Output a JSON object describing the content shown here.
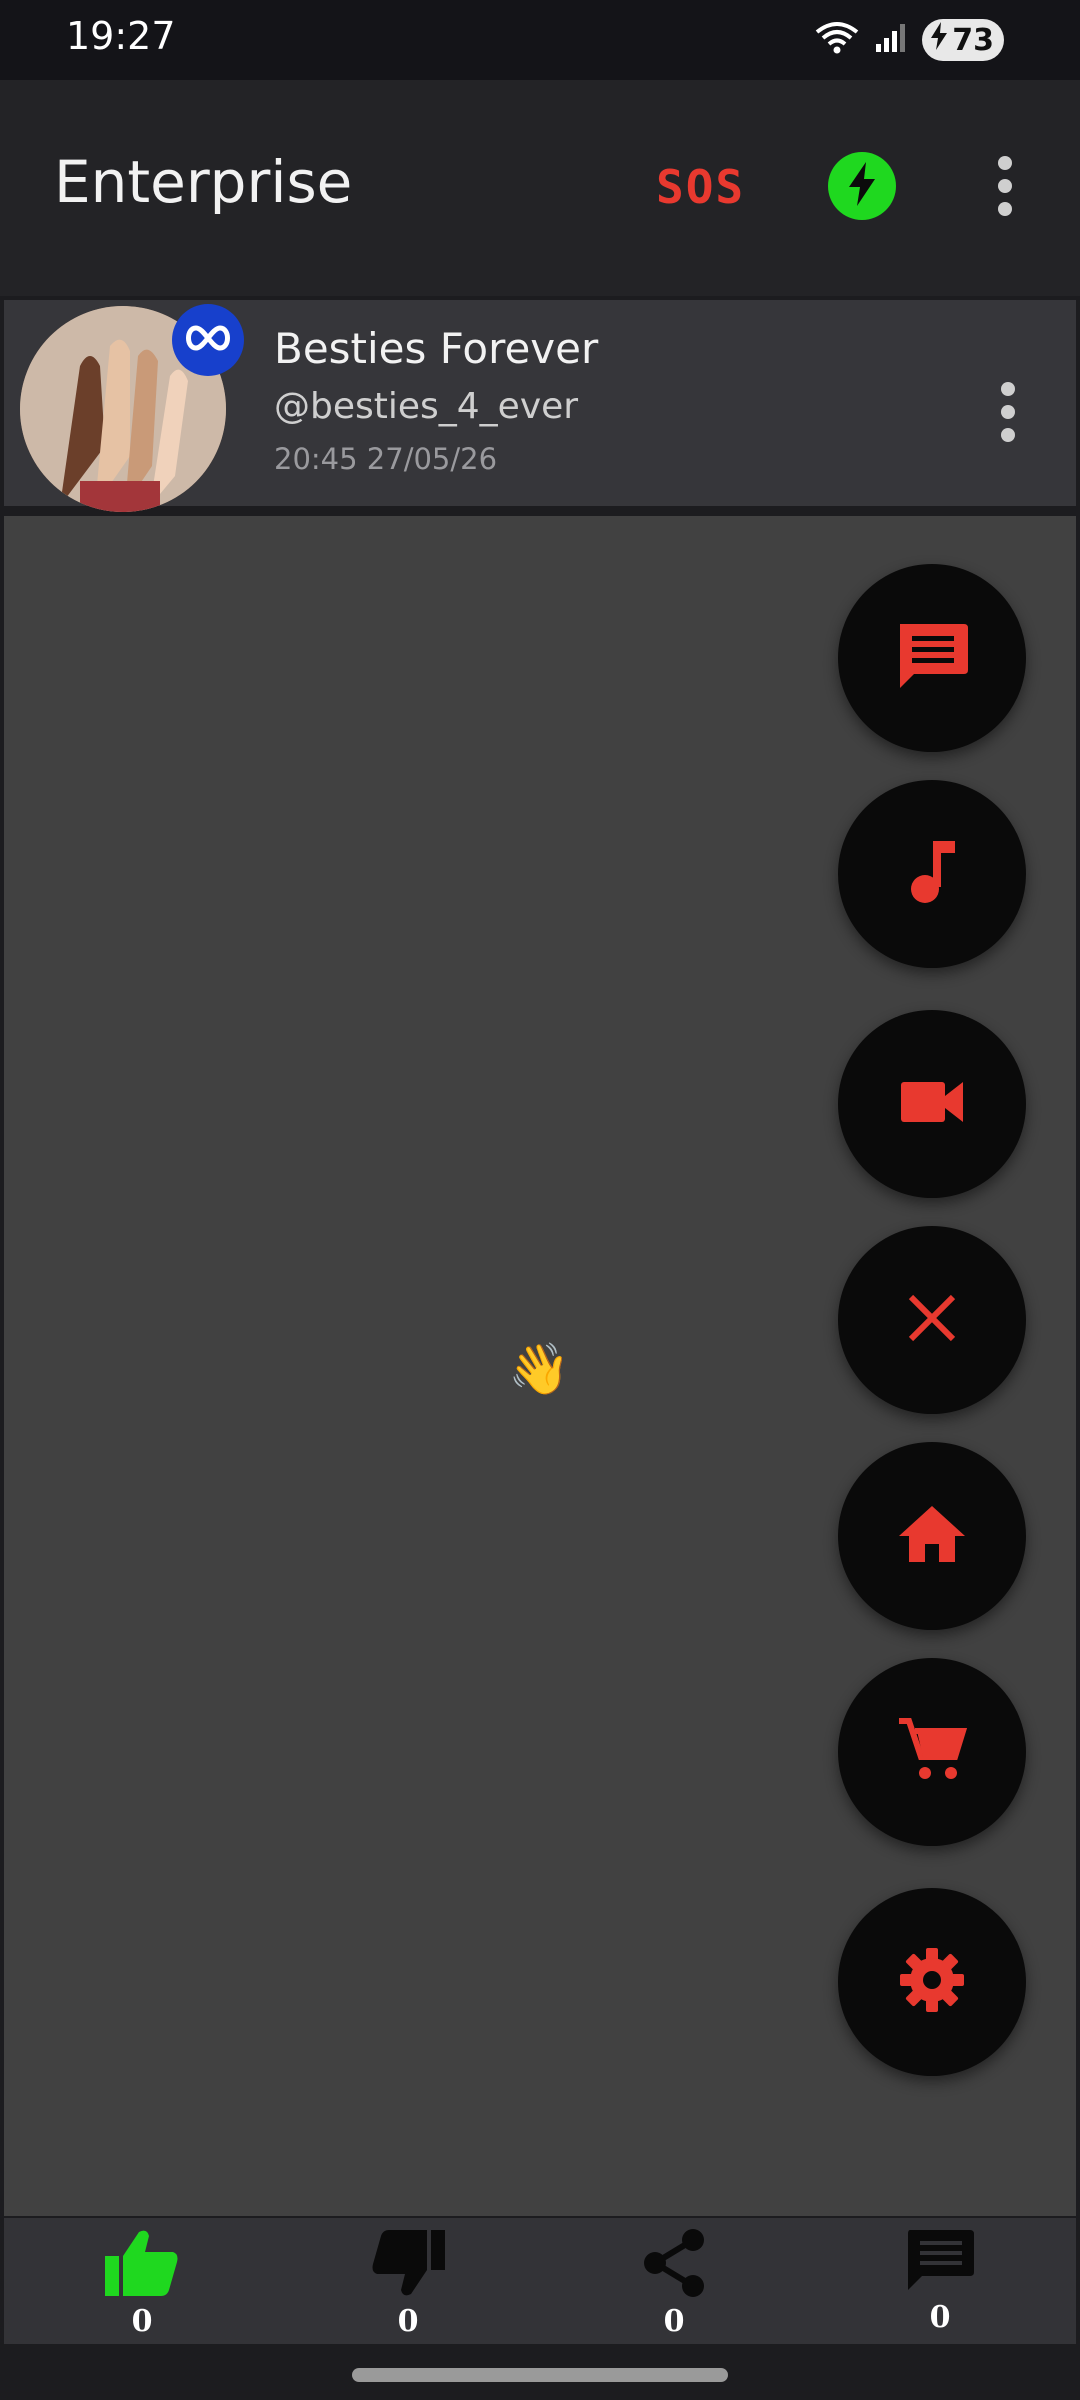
{
  "status_bar": {
    "time": "19:27",
    "battery": "73"
  },
  "app_bar": {
    "title": "Enterprise",
    "sos_label": "SOS"
  },
  "profile": {
    "name": "Besties Forever",
    "handle": "@besties_4_ever",
    "timestamp": "20:45 27/05/26"
  },
  "content": {
    "emoji": "👋"
  },
  "fab_menu": [
    {
      "name": "chat-fab-button",
      "icon": "chat-icon"
    },
    {
      "name": "music-fab-button",
      "icon": "music-note-icon"
    },
    {
      "name": "video-fab-button",
      "icon": "videocam-icon"
    },
    {
      "name": "close-fab-button",
      "icon": "close-icon"
    },
    {
      "name": "home-fab-button",
      "icon": "home-icon"
    },
    {
      "name": "cart-fab-button",
      "icon": "cart-icon"
    },
    {
      "name": "settings-fab-button",
      "icon": "gear-icon"
    }
  ],
  "bottom_bar": {
    "likes": "0",
    "dislikes": "0",
    "shares": "0",
    "comments": "0"
  },
  "colors": {
    "accent": "#e8392f",
    "like_green": "#1fd81f",
    "fab_bg": "#0a0a0a",
    "badge_blue": "#1740cc"
  }
}
